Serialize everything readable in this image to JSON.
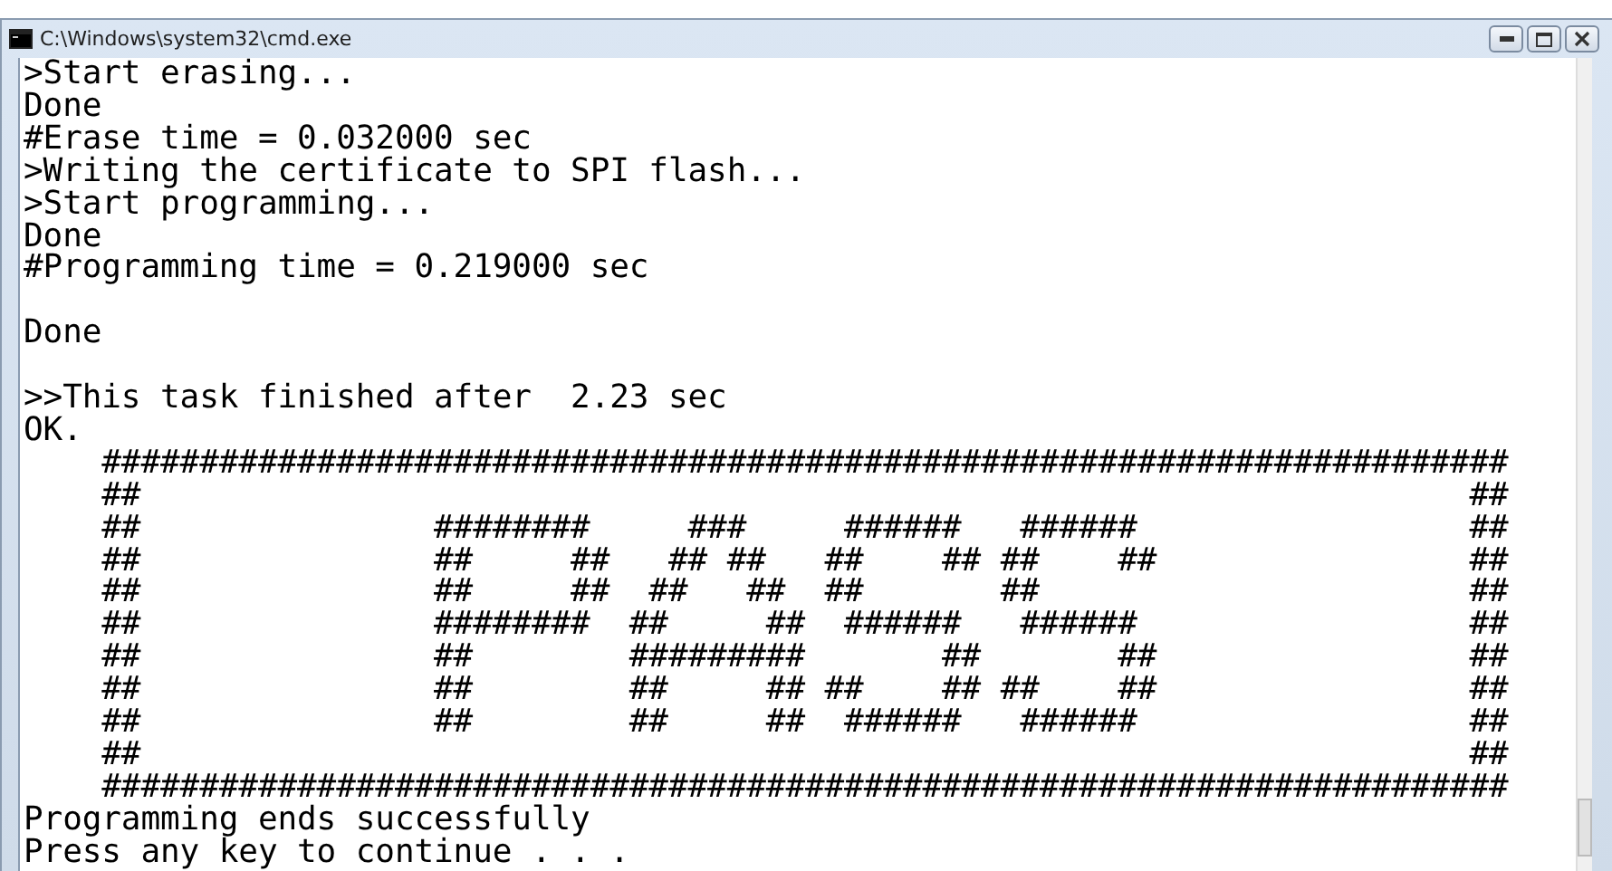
{
  "window": {
    "title": "C:\\Windows\\system32\\cmd.exe"
  },
  "console": {
    "blocks": [
      {
        "lines": [
          ">Start erasing...",
          "Done",
          "#Erase time = 0.032000 sec",
          ">Writing the certificate to SPI flash...",
          ">Start programming...",
          "Done",
          "#Programming time = 0.219000 sec"
        ]
      },
      {
        "lines": [
          "Done"
        ]
      },
      {
        "lines": [
          ">>This task finished after  2.23 sec",
          "OK.",
          "    ########################################################################",
          "    ##                                                                    ##",
          "    ##               ########     ###     ######   ######                 ##",
          "    ##               ##     ##   ## ##   ##    ## ##    ##                ##",
          "    ##               ##     ##  ##   ##  ##       ##                      ##",
          "    ##               ########  ##     ##  ######   ######                 ##",
          "    ##               ##        #########       ##       ##                ##",
          "    ##               ##        ##     ## ##    ## ##    ##                ##",
          "    ##               ##        ##     ##  ######   ######                 ##",
          "    ##                                                                    ##",
          "    ########################################################################",
          "Programming ends successfully",
          "Press any key to continue . . ."
        ]
      }
    ]
  }
}
